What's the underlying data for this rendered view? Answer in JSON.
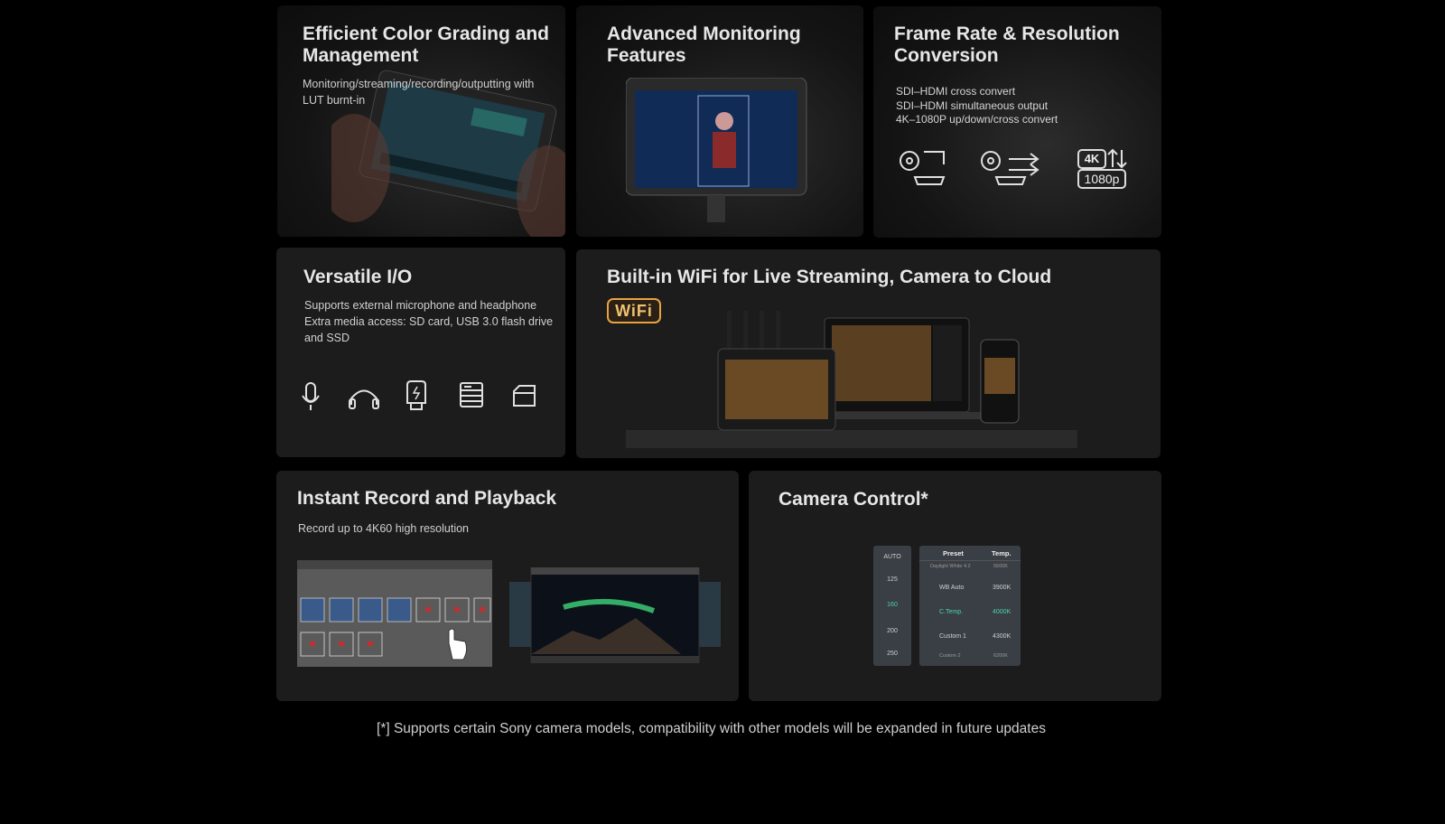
{
  "cards": {
    "color": {
      "title": "Efficient Color Grading and Management",
      "desc": "Monitoring/streaming/recording/outputting with LUT burnt-in"
    },
    "monitoring": {
      "title": "Advanced Monitoring Features"
    },
    "framerate": {
      "title": "Frame Rate & Resolution Conversion",
      "lines": [
        "SDI–HDMI cross convert",
        "SDI–HDMI simultaneous output",
        "4K–1080P up/down/cross convert"
      ],
      "badge_4k": "4K",
      "badge_1080": "1080p"
    },
    "io": {
      "title": "Versatile I/O",
      "lines": [
        "Supports external microphone and headphone",
        "Extra media access: SD card, USB 3.0 flash drive",
        "and SSD"
      ]
    },
    "wifi": {
      "title": "Built-in WiFi for Live Streaming, Camera to Cloud",
      "badge": "WiFi"
    },
    "record": {
      "title": "Instant Record and Playback",
      "desc": "Record up to 4K60 high resolution"
    },
    "camera": {
      "title": "Camera Control*",
      "shutter": [
        "AUTO",
        "125",
        "160",
        "200",
        "250"
      ],
      "table_headers": [
        "Preset",
        "Temp."
      ],
      "table_rows": [
        [
          "Daylight White 4.2",
          "5600K"
        ],
        [
          "WB Auto",
          "3900K"
        ],
        [
          "C.Temp.",
          "4000K"
        ],
        [
          "Custom 1",
          "4300K"
        ],
        [
          "Custom 2",
          "6200K"
        ]
      ]
    }
  },
  "footnote": "[*] Supports certain Sony camera models, compatibility with other models will be expanded in future updates",
  "colors": {
    "accent_green": "#4fd1a8",
    "wifi_orange": "#e8a341"
  }
}
